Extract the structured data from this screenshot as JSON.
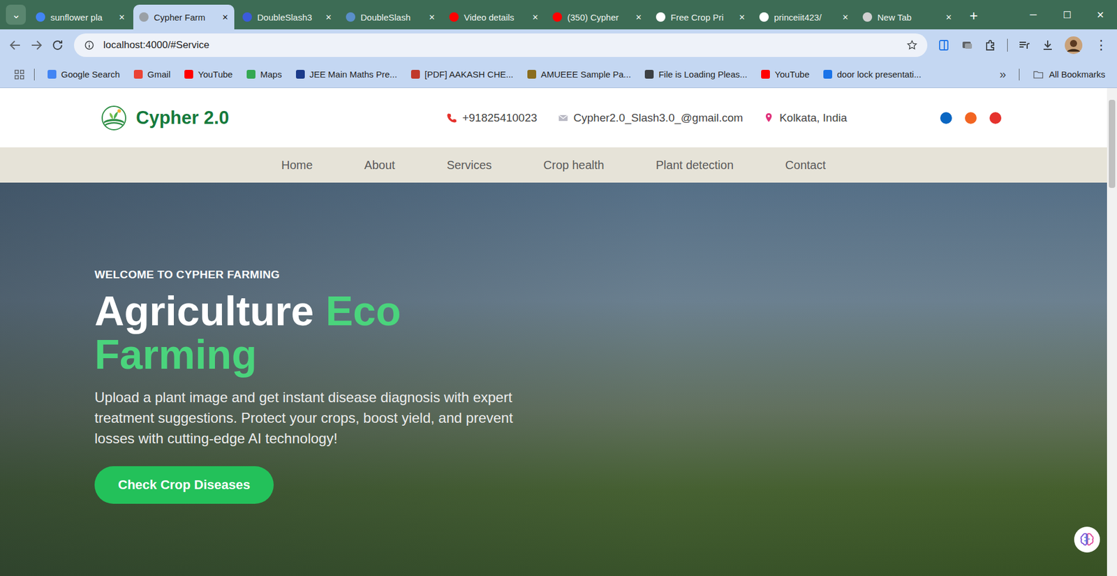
{
  "browser": {
    "tab_search": "⌄",
    "tabs": [
      {
        "label": "sunflower pla",
        "selected": false,
        "color": "#4285f4"
      },
      {
        "label": "Cypher Farm",
        "selected": true,
        "color": "#9aa0a6"
      },
      {
        "label": "DoubleSlash3",
        "selected": false,
        "color": "#3b5bdb"
      },
      {
        "label": "DoubleSlash",
        "selected": false,
        "color": "#5a8fc8"
      },
      {
        "label": "Video details",
        "selected": false,
        "color": "#ff0000"
      },
      {
        "label": "(350) Cypher",
        "selected": false,
        "color": "#ff0000"
      },
      {
        "label": "Free Crop Pri",
        "selected": false,
        "color": "#ffffff"
      },
      {
        "label": "princeiit423/",
        "selected": false,
        "color": "#ffffff"
      },
      {
        "label": "New Tab",
        "selected": false,
        "color": "#d0d0d0"
      }
    ],
    "tab_close": "✕",
    "new_tab": "+",
    "window_controls": [
      "─",
      "☐",
      "✕"
    ],
    "address": "localhost:4000/#Service",
    "menu": "⋮",
    "bookmarks": [
      {
        "label": "Google Search",
        "color": "#4285f4"
      },
      {
        "label": "Gmail",
        "color": "#ea4335"
      },
      {
        "label": "YouTube",
        "color": "#ff0000"
      },
      {
        "label": "Maps",
        "color": "#34a853"
      },
      {
        "label": "JEE Main Maths Pre...",
        "color": "#1a3a8a"
      },
      {
        "label": "[PDF] AAKASH CHE...",
        "color": "#c0392b"
      },
      {
        "label": "AMUEEE Sample Pa...",
        "color": "#8a6d1e"
      },
      {
        "label": "File is Loading Pleas...",
        "color": "#3c4043"
      },
      {
        "label": "YouTube",
        "color": "#ff0000"
      },
      {
        "label": "door lock presentati...",
        "color": "#1a73e8"
      }
    ],
    "bookmarks_more": "»",
    "all_bookmarks": "All Bookmarks"
  },
  "page": {
    "brand": "Cypher 2.0",
    "contacts": [
      {
        "kind": "phone",
        "text": "+91825410023"
      },
      {
        "kind": "mail",
        "text": "Cypher2.0_Slash3.0_@gmail.com"
      },
      {
        "kind": "location",
        "text": "Kolkata, India"
      }
    ],
    "socials": [
      {
        "color": "#0a66c2"
      },
      {
        "color": "#f26522"
      },
      {
        "color": "#e5322d"
      }
    ],
    "nav": [
      {
        "label": "Home"
      },
      {
        "label": "About"
      },
      {
        "label": "Services"
      },
      {
        "label": "Crop health"
      },
      {
        "label": "Plant detection"
      },
      {
        "label": "Contact"
      }
    ],
    "hero": {
      "eyebrow": "WELCOME TO CYPHER FARMING",
      "title_lines": [
        [
          {
            "text": "Agriculture",
            "accent": false
          },
          {
            "text": "Eco",
            "accent": true
          }
        ],
        [
          {
            "text": "Farming",
            "accent": true
          }
        ]
      ],
      "text": "Upload a plant image and get instant disease diagnosis with expert treatment suggestions. Protect your crops, boost yield, and prevent losses with cutting-edge AI technology!",
      "button": "Check Crop Diseases"
    }
  }
}
